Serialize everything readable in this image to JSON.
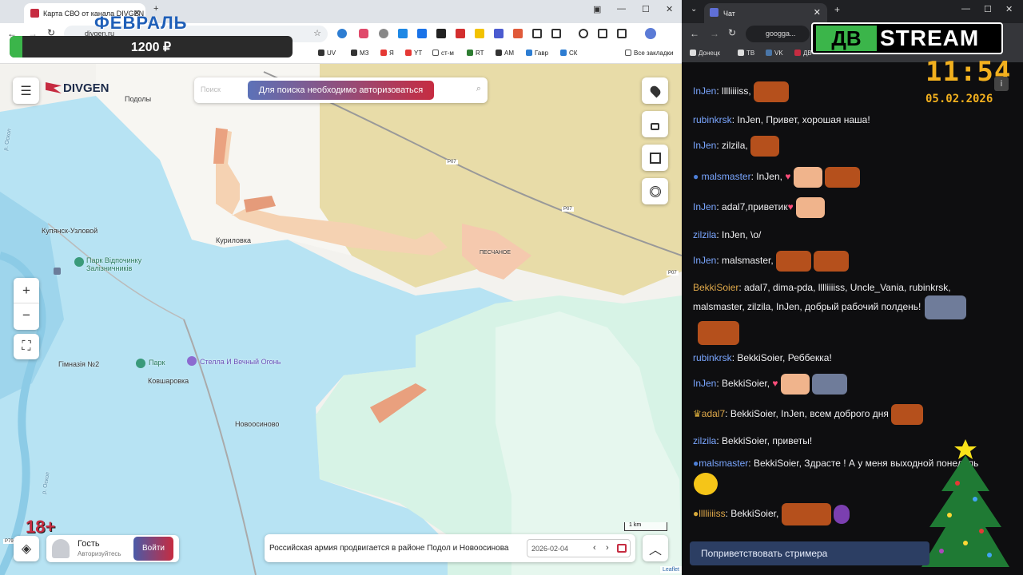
{
  "left_browser": {
    "tab_title": "Карта СВО от канала DIVGEN",
    "url": "divgen.ru",
    "overlay_month": "ФЕВРАЛЬ",
    "overlay_amount": "1200 ₽",
    "bookmarks": [
      "ДВ",
      "UV",
      "МЗ",
      "Я",
      "YT",
      "ст-м",
      "RT",
      "АМ",
      "Гавр",
      "СК"
    ],
    "all_bookmarks": "Все закладки"
  },
  "map": {
    "logo": "DIVGEN",
    "search_placeholder": "Поиск",
    "search_auth": "Для поиска необходимо авторизоваться",
    "places": {
      "podoly": "Подолы",
      "kupyansk": "Купянск-Узловой",
      "kurilovka": "Куриловка",
      "peschanoe": "ПЕСЧАНОЕ",
      "park_railway": "Парк Відпочинку Залізничників",
      "gymnasium": "Гімназія №2",
      "park": "Парк",
      "stella": "Стелла И Вечный Огонь",
      "kovsharovka": "Ковшаровка",
      "novoosinovo": "Новоосиново",
      "river1": "р. Оскол",
      "river2": "р. Оскол",
      "road1": "P07",
      "road2": "P07",
      "road3": "P07",
      "road4": "P79"
    },
    "scale": "1 km",
    "attribution": "Leaflet",
    "zoom_in": "+",
    "zoom_out": "−",
    "age_badge": "18+",
    "guest_name": "Гость",
    "guest_sub": "Авторизуйтесь",
    "login_label": "Войти",
    "news_text": "Российская армия продвигается в районе Подол и Новоосинова",
    "date_value": "2026-02-04"
  },
  "right_browser": {
    "tab_title": "Чат",
    "url": "googga...",
    "bookmarks": [
      "Донецк",
      "ТВ",
      "VK",
      "ДВ"
    ],
    "stream_logo_left": "ДВ",
    "stream_logo_right": "STREAM",
    "clock_time": "11:54",
    "clock_date": "05.02.2026",
    "greet_button": "Поприветствовать стримера"
  },
  "chat": [
    {
      "user": "InJen",
      "color": "#7aa6ff",
      "text": "lllliiiiss,"
    },
    {
      "user": "rubinkrsk",
      "color": "#7aa6ff",
      "text": "InJen, Привет, хорошая наша!"
    },
    {
      "user": "InJen",
      "color": "#7aa6ff",
      "text": "zilzila,"
    },
    {
      "user": "malsmaster",
      "color": "#7aa6ff",
      "text": "InJen,"
    },
    {
      "user": "InJen",
      "color": "#7aa6ff",
      "text": "adal7,приветик"
    },
    {
      "user": "zilzila",
      "color": "#7aa6ff",
      "text": "InJen, \\o/"
    },
    {
      "user": "InJen",
      "color": "#7aa6ff",
      "text": "malsmaster,"
    },
    {
      "user": "BekkiSoier",
      "color": "#e0a94a",
      "text": "adal7, dima-pda, lllliiiiss, Uncle_Vania, rubinkrsk, malsmaster, zilzila, InJen, добрый рабочий полдень!"
    },
    {
      "user": "rubinkrsk",
      "color": "#7aa6ff",
      "text": "BekkiSoier, Реббекка!"
    },
    {
      "user": "InJen",
      "color": "#7aa6ff",
      "text": "BekkiSoier,"
    },
    {
      "user": "adal7",
      "color": "#e0a94a",
      "text": "BekkiSoier, InJen, всем доброго дня"
    },
    {
      "user": "zilzila",
      "color": "#7aa6ff",
      "text": "BekkiSoier, приветы!"
    },
    {
      "user": "malsmaster",
      "color": "#7aa6ff",
      "text": "BekkiSoier, Здрасте ! А у меня выходной понедель"
    },
    {
      "user": "lllliiiiss",
      "color": "#e0a94a",
      "text": "BekkiSoier,"
    }
  ],
  "colors": {
    "accent_red": "#c62c41",
    "login_grad_start": "#4a5aa8",
    "map_blue": "#b7e3f3",
    "map_tan": "#e8dca8",
    "map_mint": "#d7f3e6"
  }
}
